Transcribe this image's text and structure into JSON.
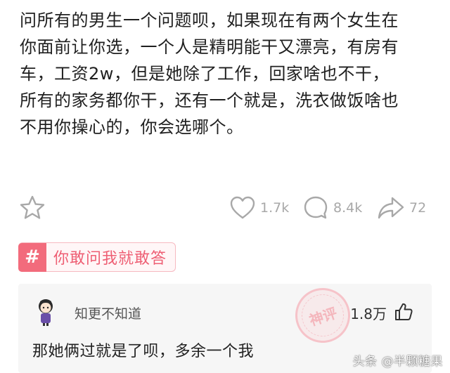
{
  "post": {
    "lines": [
      "问所有的男生一个问题呗，如果现在有两个女生在",
      "你面前让你选，一个人是精明能干又漂亮，有房有",
      "车，工资2w，但是她除了工作，回家啥也不干，",
      "所有的家务都你干，还有一个就是，洗衣做饭啥也",
      "不用你操心的，你会选哪个。"
    ]
  },
  "actions": {
    "favorite_icon": "star-outline-icon",
    "like_icon": "heart-outline-icon",
    "like_count": "1.7k",
    "comment_icon": "speech-bubble-icon",
    "comment_count": "8.4k",
    "share_icon": "share-arrow-icon",
    "share_count": "72"
  },
  "topic": {
    "icon": "hashtag-icon",
    "symbol": "#",
    "label": "你敢问我就敢答",
    "accent": "#f26b7c"
  },
  "hot_comment": {
    "username": "知更不知道",
    "like_count": "1.8万",
    "text": "那她俩过就是了呗，多余一个我",
    "stamp": "神评"
  },
  "watermark": "头条 @半颗糖果",
  "colors": {
    "icon_gray": "#a8a8a8",
    "tag_pink": "#ee5f74",
    "card_bg": "#f6f6f6"
  }
}
